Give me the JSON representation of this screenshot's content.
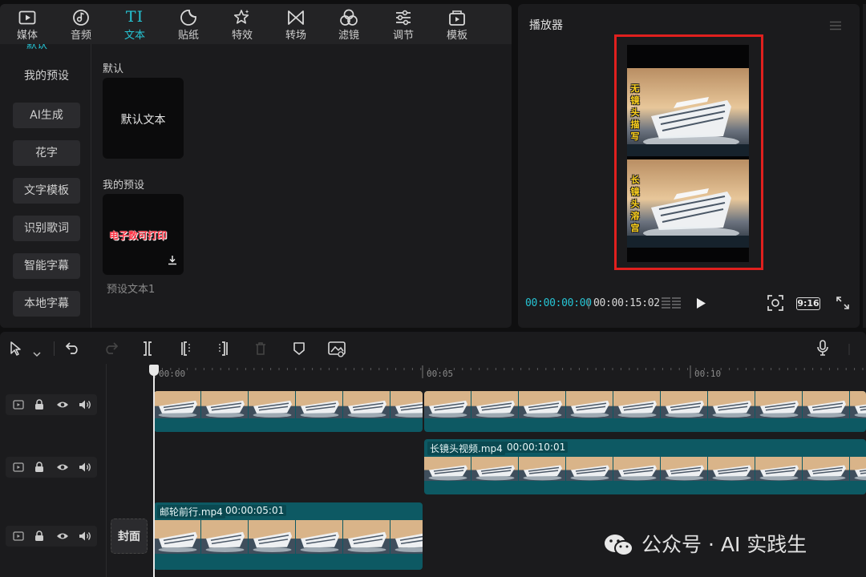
{
  "toolbar": {
    "items": [
      {
        "label": "媒体",
        "icon": "media-icon"
      },
      {
        "label": "音频",
        "icon": "audio-icon"
      },
      {
        "label": "文本",
        "icon": "text-icon",
        "glyph": "TI",
        "active": true
      },
      {
        "label": "贴纸",
        "icon": "sticker-icon"
      },
      {
        "label": "特效",
        "icon": "effects-icon"
      },
      {
        "label": "转场",
        "icon": "transition-icon"
      },
      {
        "label": "滤镜",
        "icon": "filter-icon"
      },
      {
        "label": "调节",
        "icon": "adjust-icon"
      },
      {
        "label": "模板",
        "icon": "template-icon"
      }
    ],
    "accent_color": "#26c4d4"
  },
  "sidebar": {
    "cut_item": "默认",
    "items": [
      {
        "label": "我的预设"
      },
      {
        "label": "AI生成"
      },
      {
        "label": "花字"
      },
      {
        "label": "文字模板"
      },
      {
        "label": "识别歌词"
      },
      {
        "label": "智能字幕"
      },
      {
        "label": "本地字幕"
      }
    ]
  },
  "content": {
    "default_section": "默认",
    "default_card_text": "默认文本",
    "preset_section": "我的预设",
    "preset_card_art": "电子数可打印",
    "preset_caption": "预设文本1"
  },
  "player": {
    "title": "播放器",
    "current_time": "00:00:00:00",
    "total_time": "00:00:15:02",
    "aspect_ratio": "9:16",
    "frame_border_color": "#e0201e",
    "top_caption": "无镜头描写",
    "bottom_caption": "长镜头溶宫"
  },
  "timeline": {
    "ruler": [
      "00:00",
      "00:05",
      "00:10"
    ],
    "clips": {
      "middle_name": "长镜头视频.mp4",
      "middle_duration": "00:00:10:01",
      "bottom_name": "邮轮前行.mp4",
      "bottom_duration": "00:00:05:01"
    },
    "cover_label": "封面",
    "clip_color": "#0d5963"
  },
  "watermark": {
    "text": "公众号 · AI 实践生"
  }
}
